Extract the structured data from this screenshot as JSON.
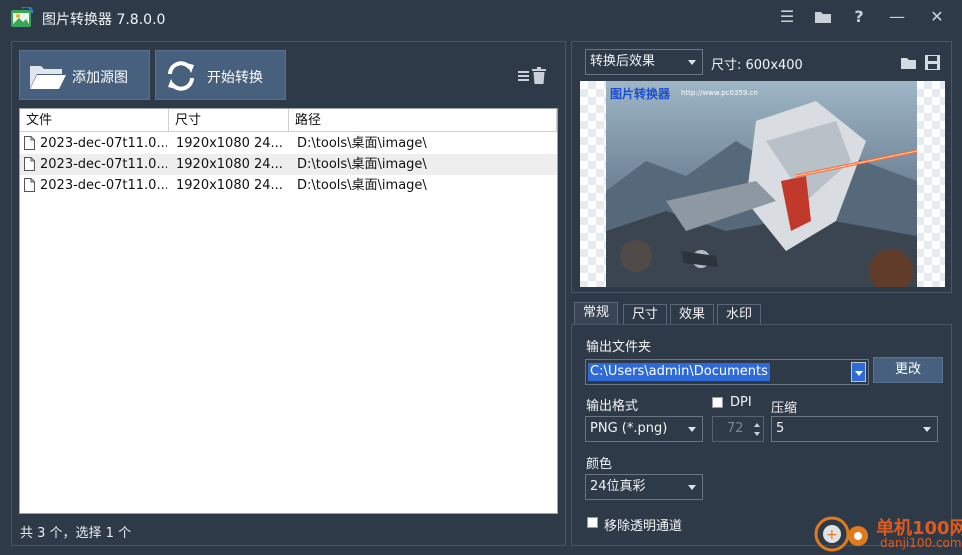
{
  "app": {
    "title": "图片转换器 7.8.0.0"
  },
  "titlebar_buttons": [
    "menu-icon",
    "folder-icon",
    "help-icon",
    "minimize-icon",
    "close-icon"
  ],
  "titlebar_glyphs": {
    "menu": "☰",
    "help": "?",
    "minimize": "—",
    "close": "✕"
  },
  "toolbar": {
    "add_source_label": "添加源图",
    "start_convert_label": "开始转换"
  },
  "table": {
    "headers": [
      "文件",
      "尺寸",
      "路径"
    ],
    "rows": [
      {
        "file": "2023-dec-07t11.0...",
        "size": "1920x1080  24...",
        "path": "D:\\tools\\桌面\\image\\"
      },
      {
        "file": "2023-dec-07t11.0...",
        "size": "1920x1080  24...",
        "path": "D:\\tools\\桌面\\image\\"
      },
      {
        "file": "2023-dec-07t11.0...",
        "size": "1920x1080  24...",
        "path": "D:\\tools\\桌面\\image\\"
      }
    ]
  },
  "status": "共 3 个，选择 1 个",
  "preview": {
    "mode": "转换后效果",
    "size_text": "尺寸: 600x400",
    "watermark_text": "图片转换器",
    "watermark_url": "http://www.pc0359.cn"
  },
  "tabs": [
    "常规",
    "尺寸",
    "效果",
    "水印"
  ],
  "active_tab": 0,
  "settings": {
    "output_folder_label": "输出文件夹",
    "output_folder_value": "C:\\Users\\admin\\Documents",
    "change_label": "更改",
    "output_format_label": "输出格式",
    "output_format_value": "PNG (*.png)",
    "dpi_label": "DPI",
    "dpi_value": "72",
    "compress_label": "压缩",
    "compress_value": "5",
    "color_label": "颜色",
    "color_value": "24位真彩",
    "remove_alpha_label": "移除透明通道"
  },
  "brand": {
    "name": "单机100网",
    "url": "danji100.com"
  },
  "colors": {
    "background": "#2f3a48",
    "button": "#47607e",
    "selection": "#2e6bd6"
  }
}
